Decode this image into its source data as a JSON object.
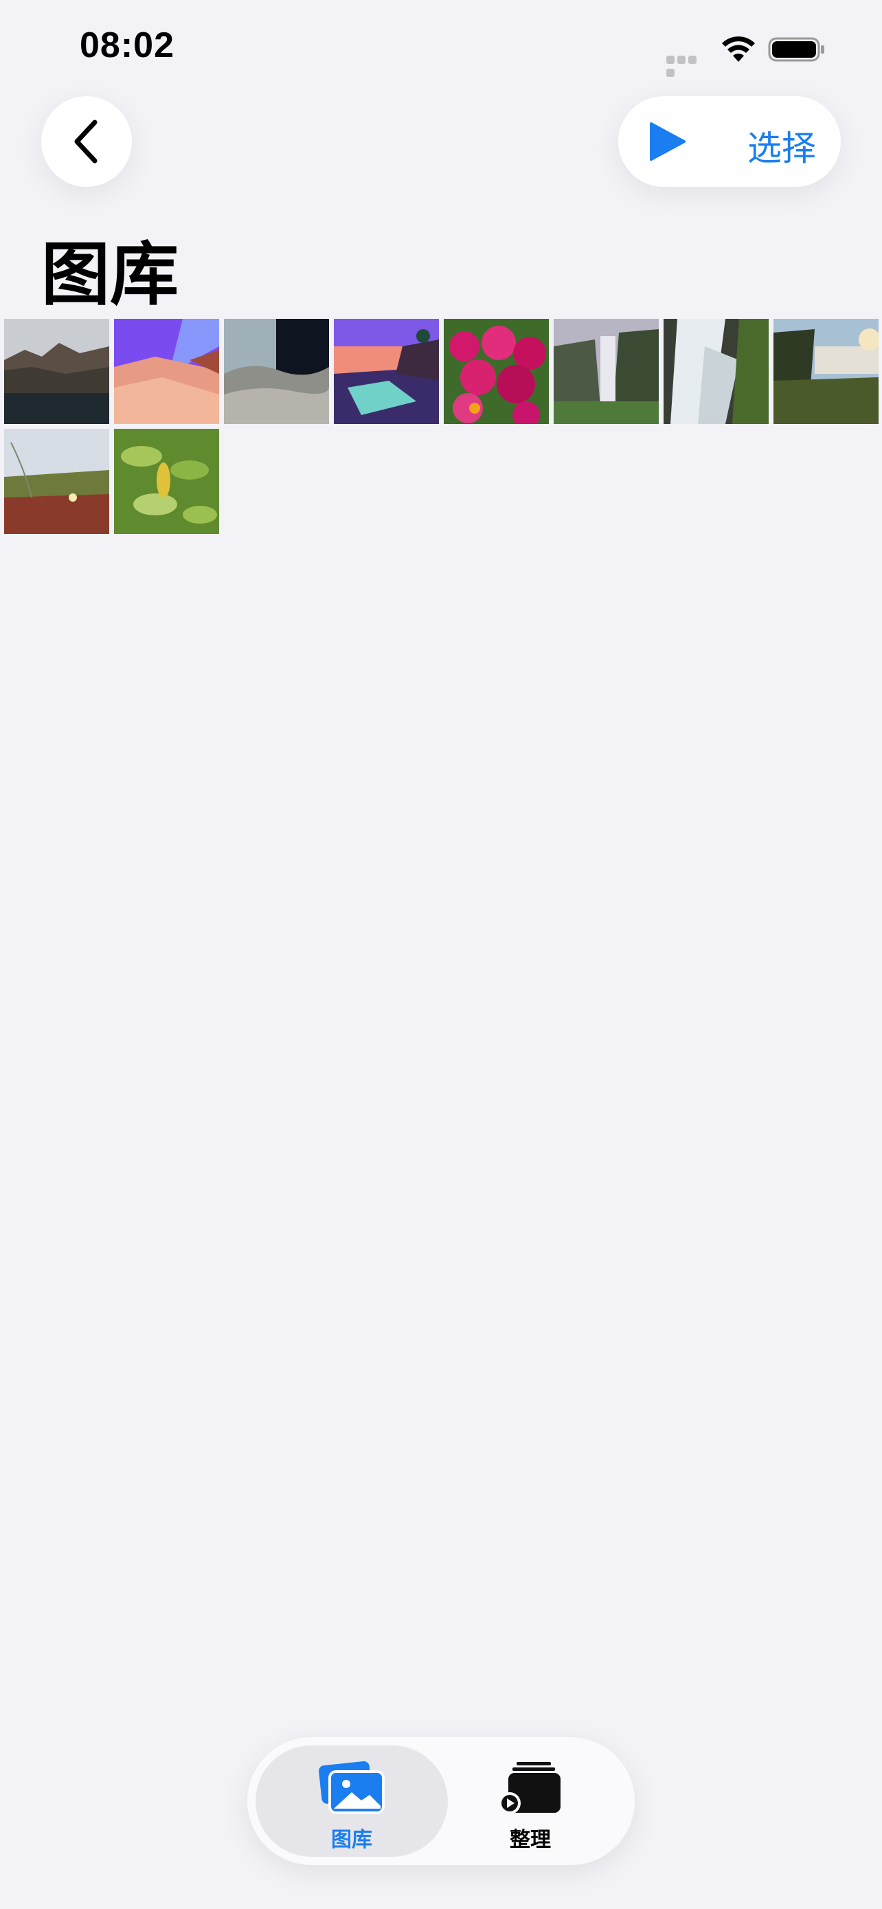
{
  "status_bar": {
    "time": "08:02",
    "icons": [
      "cellular-signal-icon",
      "wifi-icon",
      "battery-icon"
    ]
  },
  "nav": {
    "back_icon": "chevron-left-icon",
    "play_icon": "play-icon",
    "select_label": "选择"
  },
  "page": {
    "title": "图库"
  },
  "gallery": {
    "thumbnails": [
      {
        "subject": "mountains-and-lake"
      },
      {
        "subject": "purple-desert-dunes-illustration"
      },
      {
        "subject": "grey-sand-dunes-dark-sky"
      },
      {
        "subject": "sunset-coast-illustration"
      },
      {
        "subject": "magenta-flowers"
      },
      {
        "subject": "waterfall-cliff"
      },
      {
        "subject": "cascading-waterfall"
      },
      {
        "subject": "waterfall-at-dusk"
      },
      {
        "subject": "grass-and-wildflowers"
      },
      {
        "subject": "green-leaves"
      }
    ]
  },
  "tabbar": {
    "tabs": [
      {
        "label": "图库",
        "icon": "photo-library-icon",
        "selected": true
      },
      {
        "label": "整理",
        "icon": "slideshow-stack-icon",
        "selected": false
      }
    ]
  },
  "colors": {
    "accent": "#1a7ef1",
    "background": "#f2f2f7"
  }
}
